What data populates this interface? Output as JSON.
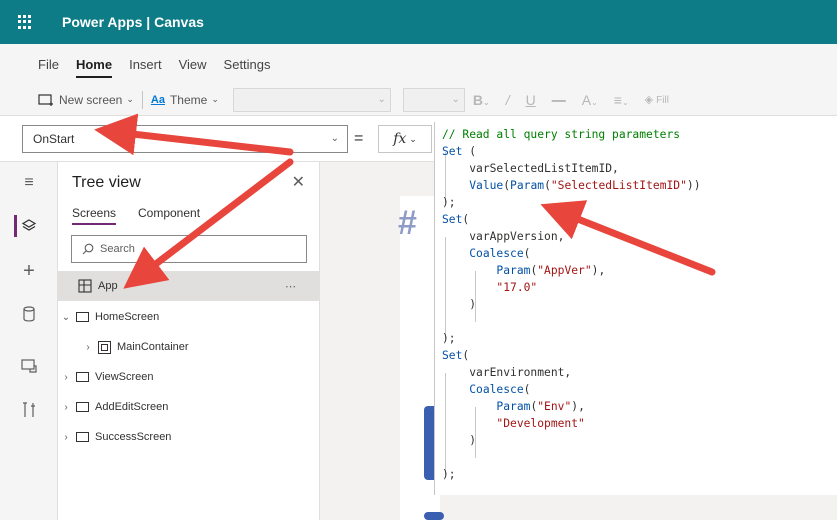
{
  "header": {
    "title": "Power Apps | Canvas"
  },
  "menu": {
    "items": [
      "File",
      "Home",
      "Insert",
      "View",
      "Settings"
    ],
    "active": "Home"
  },
  "toolbar": {
    "new_screen": "New screen",
    "theme": "Theme",
    "fill": "Fill"
  },
  "formula_bar": {
    "property": "OnStart",
    "equals": "=",
    "fx": "fx"
  },
  "tree_view": {
    "title": "Tree view",
    "tabs": [
      "Screens",
      "Component"
    ],
    "search_placeholder": "Search",
    "items": [
      {
        "label": "App",
        "level": 0
      },
      {
        "label": "HomeScreen",
        "level": 0
      },
      {
        "label": "MainContainer",
        "level": 1
      },
      {
        "label": "ViewScreen",
        "level": 0
      },
      {
        "label": "AddEditScreen",
        "level": 0
      },
      {
        "label": "SuccessScreen",
        "level": 0
      }
    ]
  },
  "code": {
    "comment": "// Read all query string parameters",
    "set": "Set",
    "var1": "varSelectedListItemID,",
    "value_fn": "Value",
    "param_fn": "Param",
    "coalesce_fn": "Coalesce",
    "param1": "\"SelectedListItemID\"",
    "var2": "varAppVersion,",
    "param2": "\"AppVer\"",
    "default2": "\"17.0\"",
    "var3": "varEnvironment,",
    "param3": "\"Env\"",
    "default3": "\"Development\""
  },
  "colors": {
    "header_bg": "#0e7c86",
    "accent": "#742774",
    "arrow": "#e8453c"
  }
}
